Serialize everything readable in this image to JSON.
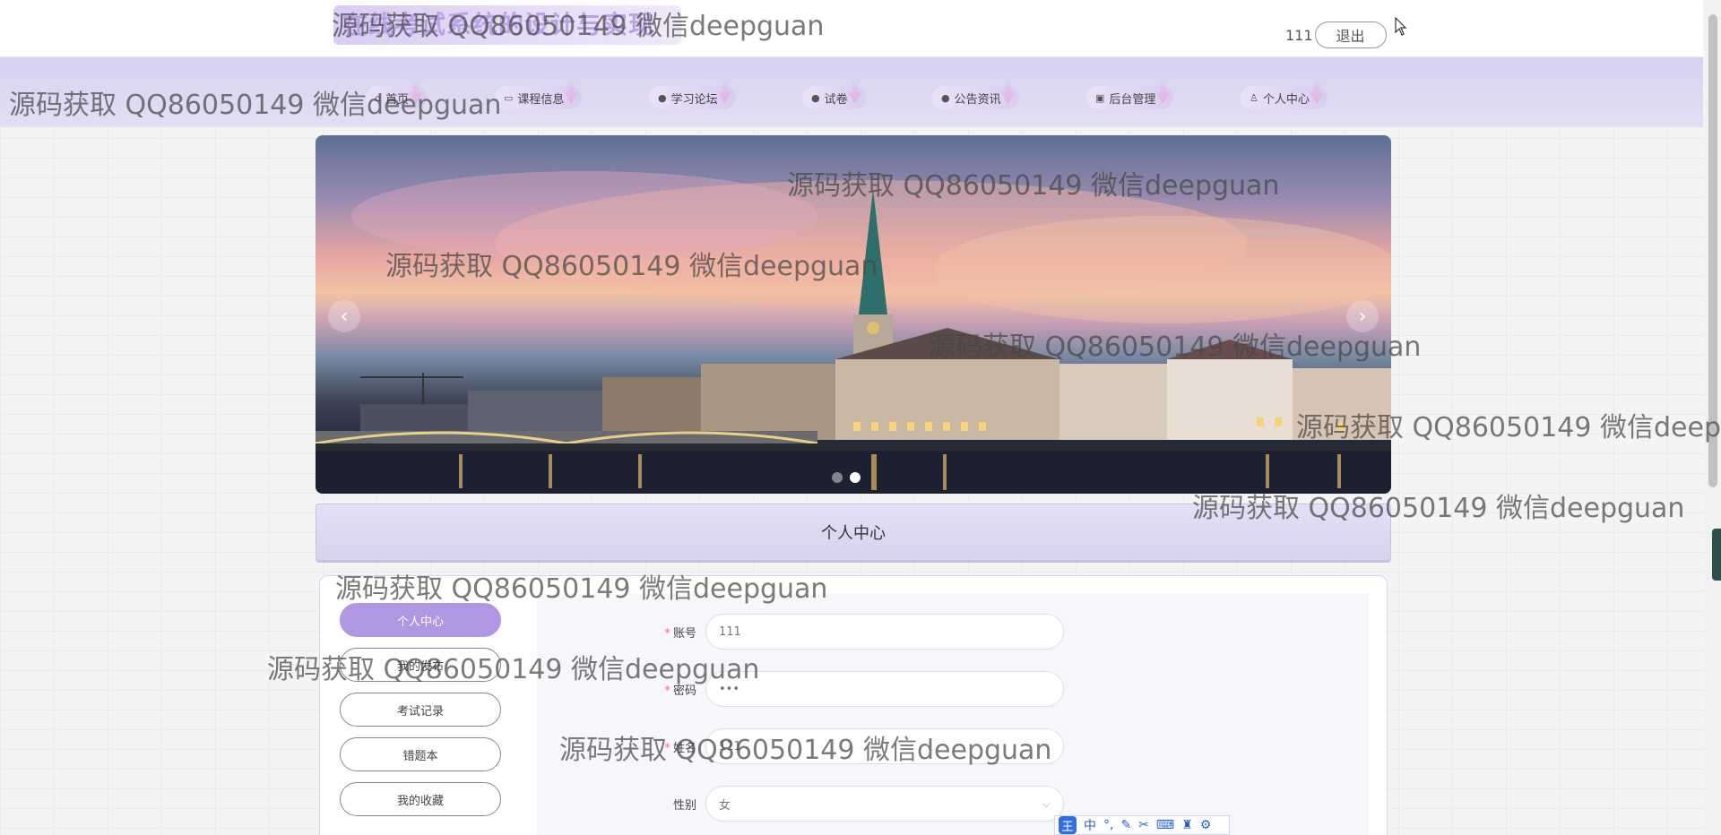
{
  "header": {
    "site_title": "在线考试系统的设计与实现",
    "user_name": "111",
    "logout_label": "退出"
  },
  "nav": {
    "items": [
      {
        "label": "首页",
        "icon": "home-icon"
      },
      {
        "label": "课程信息",
        "icon": "bag-icon"
      },
      {
        "label": "学习论坛",
        "icon": "info-icon"
      },
      {
        "label": "试卷",
        "icon": "question-icon"
      },
      {
        "label": "公告资讯",
        "icon": "info-icon"
      },
      {
        "label": "后台管理",
        "icon": "briefcase-icon"
      },
      {
        "label": "个人中心",
        "icon": "user-icon"
      }
    ]
  },
  "banner": {
    "prev_icon": "‹",
    "next_icon": "›",
    "slide_count": 2,
    "active_slide": 2
  },
  "section": {
    "title": "个人中心"
  },
  "sidebar": {
    "items": [
      {
        "label": "个人中心",
        "active": true
      },
      {
        "label": "我的发布",
        "active": false
      },
      {
        "label": "考试记录",
        "active": false
      },
      {
        "label": "错题本",
        "active": false
      },
      {
        "label": "我的收藏",
        "active": false
      }
    ]
  },
  "form": {
    "fields": [
      {
        "label": "账号",
        "required": true,
        "value": "111"
      },
      {
        "label": "密码",
        "required": true,
        "value": "•••"
      },
      {
        "label": "姓名",
        "required": true,
        "value": "111"
      },
      {
        "label": "性别",
        "required": false,
        "value": "女"
      }
    ]
  },
  "ime_toolbar": {
    "logo": "王",
    "mode": "中"
  },
  "watermark_text": "源码获取 QQ86050149 微信deepguan",
  "colors": {
    "accent": "#b196e2",
    "nav_bg": "#d7d2f0",
    "required": "#f56c6c"
  }
}
